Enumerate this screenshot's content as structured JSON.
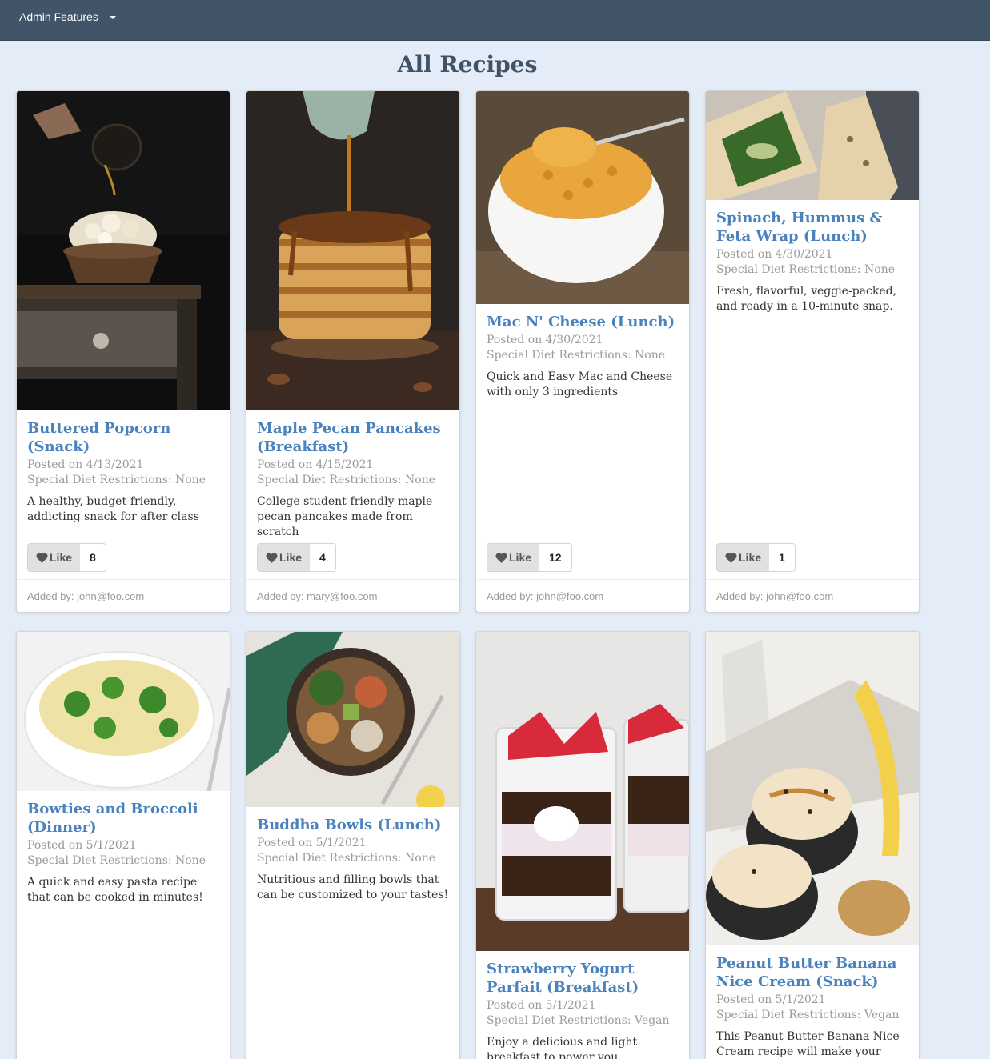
{
  "nav": {
    "admin_label": "Admin Features"
  },
  "page": {
    "title": "All Recipes"
  },
  "like_label": "Like",
  "cards": [
    {
      "title": "Buttered Popcorn (Snack)",
      "posted": "Posted on 4/13/2021",
      "diet": "Special Diet Restrictions: None",
      "description": "A healthy, budget-friendly, addicting snack for after class",
      "likes": "8",
      "added_by": "Added by: john@foo.com"
    },
    {
      "title": "Maple Pecan Pancakes (Breakfast)",
      "posted": "Posted on 4/15/2021",
      "diet": "Special Diet Restrictions: None",
      "description": "College student-friendly maple pecan pancakes made from scratch",
      "likes": "4",
      "added_by": "Added by: mary@foo.com"
    },
    {
      "title": "Mac N' Cheese (Lunch)",
      "posted": "Posted on 4/30/2021",
      "diet": "Special Diet Restrictions: None",
      "description": "Quick and Easy Mac and Cheese with only 3 ingredients",
      "likes": "12",
      "added_by": "Added by: john@foo.com"
    },
    {
      "title": "Spinach, Hummus & Feta Wrap (Lunch)",
      "posted": "Posted on 4/30/2021",
      "diet": "Special Diet Restrictions: None",
      "description": "Fresh, flavorful, veggie-packed, and ready in a 10-minute snap.",
      "likes": "1",
      "added_by": "Added by: john@foo.com"
    },
    {
      "title": "Bowties and Broccoli (Dinner)",
      "posted": "Posted on 5/1/2021",
      "diet": "Special Diet Restrictions: None",
      "description": "A quick and easy pasta recipe that can be cooked in minutes!"
    },
    {
      "title": "Buddha Bowls (Lunch)",
      "posted": "Posted on 5/1/2021",
      "diet": "Special Diet Restrictions: None",
      "description": "Nutritious and filling bowls that can be customized to your tastes!"
    },
    {
      "title": "Strawberry Yogurt Parfait (Breakfast)",
      "posted": "Posted on 5/1/2021",
      "diet": "Special Diet Restrictions: Vegan",
      "description": "Enjoy a delicious and light breakfast to power you throughout the day!"
    },
    {
      "title": "Peanut Butter Banana Nice Cream (Snack)",
      "posted": "Posted on 5/1/2021",
      "diet": "Special Diet Restrictions: Vegan",
      "description": "This Peanut Butter Banana Nice Cream recipe will make your dessert"
    }
  ]
}
